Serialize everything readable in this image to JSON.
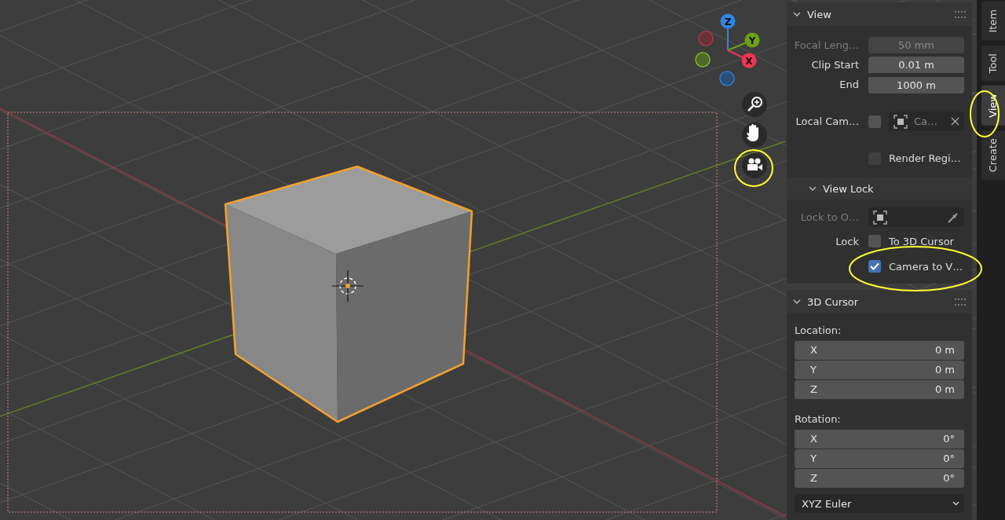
{
  "gizmo": {
    "axes": [
      {
        "label": "Z",
        "color": "#2f85e3"
      },
      {
        "label": "Y",
        "color": "#6ba21a"
      },
      {
        "label": "X",
        "color": "#ee3552"
      }
    ]
  },
  "view_panel": {
    "title": "View",
    "fields": [
      {
        "label": "Focal Leng…",
        "value": "50 mm",
        "disabled": true
      },
      {
        "label": "Clip Start",
        "value": "0.01 m",
        "disabled": false
      },
      {
        "label": "End",
        "value": "1000 m",
        "disabled": false
      }
    ],
    "local_camera": {
      "label": "Local Cam…",
      "checked": false,
      "value": "Ca…"
    },
    "render_region": {
      "label": "Render Regi…",
      "checked": false,
      "disabled": true
    },
    "view_lock": {
      "title": "View Lock",
      "lock_to_object": {
        "label": "Lock to O…"
      },
      "lock_label": "Lock",
      "options": [
        {
          "label": "To 3D Cursor",
          "checked": false
        },
        {
          "label": "Camera to V…",
          "checked": true
        }
      ]
    }
  },
  "cursor_panel": {
    "title": "3D Cursor",
    "location_label": "Location:",
    "location": [
      {
        "axis": "X",
        "value": "0 m"
      },
      {
        "axis": "Y",
        "value": "0 m"
      },
      {
        "axis": "Z",
        "value": "0 m"
      }
    ],
    "rotation_label": "Rotation:",
    "rotation": [
      {
        "axis": "X",
        "value": "0°"
      },
      {
        "axis": "Y",
        "value": "0°"
      },
      {
        "axis": "Z",
        "value": "0°"
      }
    ],
    "rotation_mode": "XYZ Euler"
  },
  "tabs": [
    {
      "label": "Item",
      "selected": false
    },
    {
      "label": "Tool",
      "selected": false
    },
    {
      "label": "View",
      "selected": true
    },
    {
      "label": "Create",
      "selected": false
    }
  ]
}
